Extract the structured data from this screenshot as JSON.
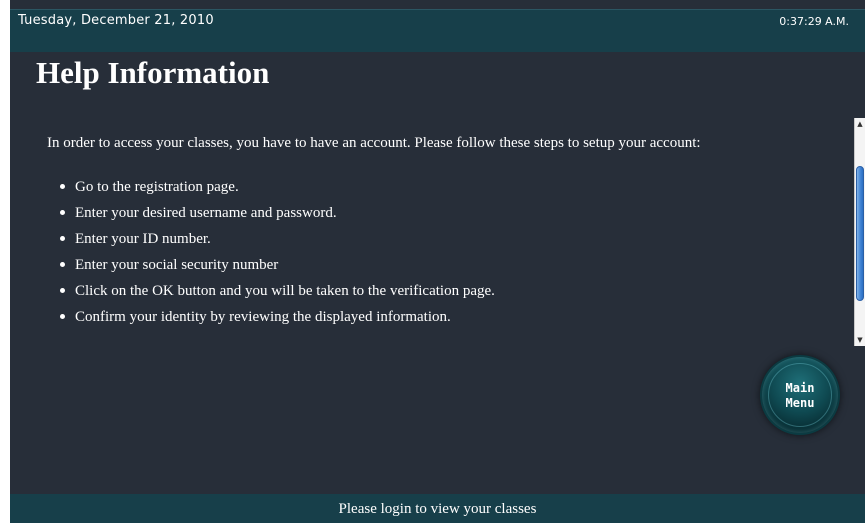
{
  "header": {
    "date": "Tuesday, December 21, 2010",
    "time": "0:37:29 A.M."
  },
  "main": {
    "title": "Help Information",
    "intro": "In order to access your classes, you have to have an account. Please follow these steps to setup your account:",
    "steps": [
      "Go to the registration page.",
      "Enter your desired username and password.",
      "Enter your ID number.",
      "Enter your social security number",
      "Click on the OK button and you will be taken to the verification page.",
      "Confirm your identity by reviewing the displayed information."
    ]
  },
  "menu_button": {
    "label": "Main\nMenu"
  },
  "footer": {
    "status": "Please login to view your classes"
  },
  "scrollbar": {
    "up_icon": "scroll-up-arrow",
    "down_icon": "scroll-down-arrow"
  },
  "colors": {
    "background": "#272e39",
    "bar": "#173f4a",
    "text": "#ffffff",
    "button": "#0f4a52"
  }
}
